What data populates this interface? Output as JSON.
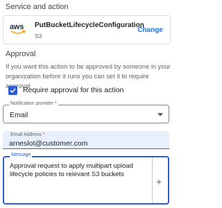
{
  "service": {
    "section_title": "Service and action",
    "logo_text": "aws",
    "action_name": "PutBucketLifecycleConfiguration",
    "service_name": "S3",
    "change_label": "Change"
  },
  "approval": {
    "section_title": "Approval",
    "help_text": "If you want this action to be approved by someone in your organization before it runs you can set it to require approval",
    "checkbox_label": "Require approval for this action",
    "checkbox_checked": true,
    "notification_provider": {
      "label": "Notification provider",
      "required_mark": "*",
      "value": "Email"
    },
    "email": {
      "label": "Email Address",
      "required_mark": "*",
      "value": "arneslot@customer.com"
    },
    "message": {
      "label": "Message",
      "value": "Approval request to apply multipart upload lifecycle policies to relevant S3 buckets",
      "add_icon": "plus-icon"
    }
  },
  "colors": {
    "accent": "#2f5bd3",
    "link": "#1a73e8",
    "autofill_bg": "#e8f0fe"
  }
}
